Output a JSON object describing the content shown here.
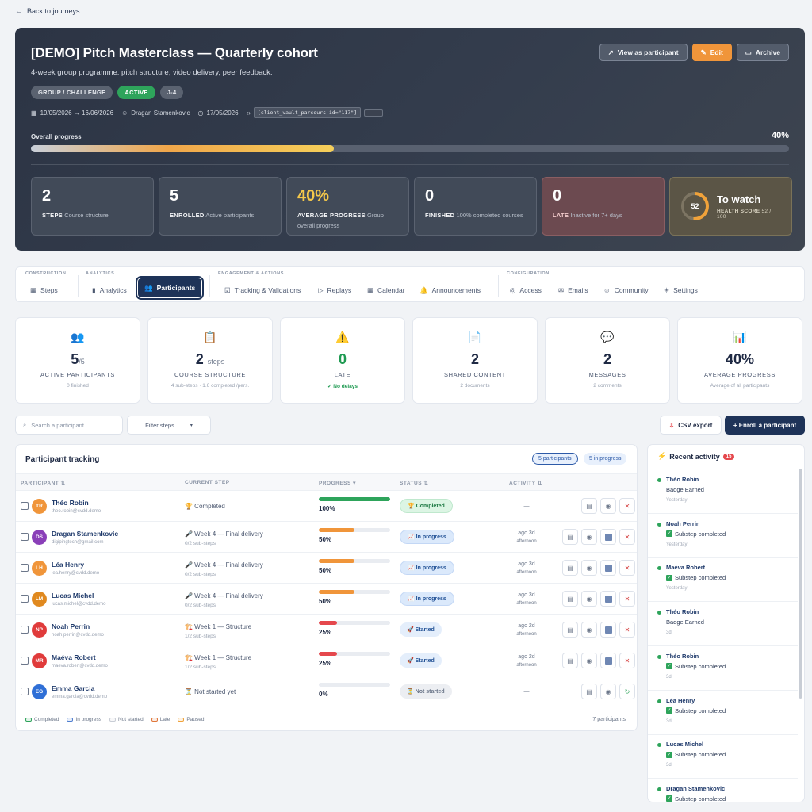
{
  "back": {
    "label": "Back to journeys"
  },
  "hero": {
    "title": "[DEMO] Pitch Masterclass — Quarterly cohort",
    "subtitle": "4-week group programme: pitch structure, video delivery, peer feedback.",
    "buttons": {
      "view": "View as participant",
      "edit": "Edit",
      "archive": "Archive"
    },
    "tags": [
      "GROUP / CHALLENGE",
      "ACTIVE",
      "J-4"
    ],
    "meta": {
      "dates": "19/05/2026 → 16/06/2026",
      "author": "Dragan Stamenkovic",
      "created": "17/05/2026",
      "code": "[client_vault_parcours id=\"117\"]"
    },
    "progress_label": "Overall progress",
    "progress_pct": "40%",
    "progress_value": 0.4,
    "kpis": [
      {
        "value": "2",
        "label": "STEPS",
        "desc": "Course structure"
      },
      {
        "value": "5",
        "label": "ENROLLED",
        "desc": "Active participants"
      },
      {
        "value": "40%",
        "label": "AVERAGE PROGRESS",
        "desc": "Group overall progress"
      },
      {
        "value": "0",
        "label": "FINISHED",
        "desc": "100% completed courses"
      },
      {
        "value": "0",
        "label": "LATE",
        "desc": "Inactive for 7+ days"
      }
    ],
    "health": {
      "score": "52",
      "title": "To watch",
      "label": "HEALTH SCORE",
      "sub": "52 / 100",
      "value": 0.52
    }
  },
  "tabs": {
    "groups": [
      "CONSTRUCTION",
      "ANALYTICS",
      "ENGAGEMENT & ACTIONS",
      "CONFIGURATION"
    ],
    "items": [
      "Steps",
      "Analytics",
      "Participants",
      "Tracking & Validations",
      "Replays",
      "Calendar",
      "Announcements",
      "Access",
      "Emails",
      "Community",
      "Settings"
    ]
  },
  "stats": [
    {
      "icon": "👥",
      "value": "5",
      "suffix": "/5",
      "label": "ACTIVE PARTICIPANTS",
      "desc": "0 finished"
    },
    {
      "icon": "📋",
      "value": "2",
      "suffix": "steps",
      "label": "COURSE STRUCTURE",
      "desc": "4 sub-steps · 1.6 completed /pers."
    },
    {
      "icon": "⚠️",
      "value": "0",
      "suffix": "",
      "label": "LATE",
      "desc": "✓ No delays"
    },
    {
      "icon": "📄",
      "value": "2",
      "suffix": "",
      "label": "SHARED CONTENT",
      "desc": "2 documents"
    },
    {
      "icon": "💬",
      "value": "2",
      "suffix": "",
      "label": "MESSAGES",
      "desc": "2 comments"
    },
    {
      "icon": "📊",
      "value": "40%",
      "suffix": "",
      "label": "AVERAGE PROGRESS",
      "desc": "Average of all participants"
    }
  ],
  "toolbar": {
    "search_placeholder": "Search a participant...",
    "filter": "Filter steps",
    "csv": "CSV export",
    "enroll": "+ Enroll a participant"
  },
  "table": {
    "title": "Participant tracking",
    "pill_participants": "5 participants",
    "pill_progress": "5 in progress",
    "headers": [
      "PARTICIPANT ⇅",
      "CURRENT STEP",
      "PROGRESS ▾",
      "STATUS ⇅",
      "ACTIVITY ⇅"
    ],
    "rows": [
      {
        "initials": "TR",
        "color": "#f0953a",
        "name": "Théo Robin",
        "email": "theo.robin@cvdd.demo",
        "step": "🏆 Completed",
        "substeps": "",
        "progress": "100%",
        "pval": 1.0,
        "bar": "#2ea45b",
        "status": "🏆 Completed",
        "stype": "done",
        "act1": "—",
        "act2": "",
        "extra": false
      },
      {
        "initials": "DS",
        "color": "#8a3fb8",
        "name": "Dragan Stamenkovic",
        "email": "digipingtech@gmail.com",
        "step": "🎤 Week 4 — Final delivery",
        "substeps": "0/2 sub-steps",
        "progress": "50%",
        "pval": 0.5,
        "bar": "#f0953a",
        "status": "📈 In progress",
        "stype": "prog",
        "act1": "ago 3d",
        "act2": "afternoon",
        "extra": true
      },
      {
        "initials": "LH",
        "color": "#f0953a",
        "name": "Léa Henry",
        "email": "lea.henry@cvdd.demo",
        "step": "🎤 Week 4 — Final delivery",
        "substeps": "0/2 sub-steps",
        "progress": "50%",
        "pval": 0.5,
        "bar": "#f0953a",
        "status": "📈 In progress",
        "stype": "prog",
        "act1": "ago 3d",
        "act2": "afternoon",
        "extra": true
      },
      {
        "initials": "LM",
        "color": "#e0891f",
        "name": "Lucas Michel",
        "email": "lucas.michel@cvdd.demo",
        "step": "🎤 Week 4 — Final delivery",
        "substeps": "0/2 sub-steps",
        "progress": "50%",
        "pval": 0.5,
        "bar": "#f0953a",
        "status": "📈 In progress",
        "stype": "prog",
        "act1": "ago 3d",
        "act2": "afternoon",
        "extra": true
      },
      {
        "initials": "NP",
        "color": "#e03b3b",
        "name": "Noah Perrin",
        "email": "noah.perrin@cvdd.demo",
        "step": "🏗️ Week 1 — Structure",
        "substeps": "1/2 sub-steps",
        "progress": "25%",
        "pval": 0.25,
        "bar": "#e5484d",
        "status": "🚀 Started",
        "stype": "start",
        "act1": "ago 2d",
        "act2": "afternoon",
        "extra": true
      },
      {
        "initials": "MR",
        "color": "#e03b3b",
        "name": "Maéva Robert",
        "email": "maeva.robert@cvdd.demo",
        "step": "🏗️ Week 1 — Structure",
        "substeps": "1/2 sub-steps",
        "progress": "25%",
        "pval": 0.25,
        "bar": "#e5484d",
        "status": "🚀 Started",
        "stype": "start",
        "act1": "ago 2d",
        "act2": "afternoon",
        "extra": true
      },
      {
        "initials": "EG",
        "color": "#2f6fd6",
        "name": "Emma Garcia",
        "email": "emma.garcia@cvdd.demo",
        "step": "⏳ Not started yet",
        "substeps": "",
        "progress": "0%",
        "pval": 0,
        "bar": "#c8cdd5",
        "status": "⏳ Not started",
        "stype": "not",
        "act1": "—",
        "act2": "",
        "extra": false,
        "restart": true
      }
    ],
    "legend": [
      "Completed",
      "In progress",
      "Not started",
      "Late",
      "Paused"
    ],
    "legend_colors": [
      "#2ea45b",
      "#4f7fd0",
      "#c8cdd5",
      "#e0763a",
      "#f0a23a"
    ],
    "count": "7 participants"
  },
  "activity": {
    "title": "Recent activity",
    "badge": "15",
    "items": [
      {
        "name": "Théo Robin",
        "text": "Badge Earned",
        "check": false,
        "date": "Yesterday"
      },
      {
        "name": "Noah Perrin",
        "text": "Substep completed",
        "check": true,
        "date": "Yesterday"
      },
      {
        "name": "Maéva Robert",
        "text": "Substep completed",
        "check": true,
        "date": "Yesterday"
      },
      {
        "name": "Théo Robin",
        "text": "Badge Earned",
        "check": false,
        "date": "3d"
      },
      {
        "name": "Théo Robin",
        "text": "Substep completed",
        "check": true,
        "date": "3d"
      },
      {
        "name": "Léa Henry",
        "text": "Substep completed",
        "check": true,
        "date": "3d"
      },
      {
        "name": "Lucas Michel",
        "text": "Substep completed",
        "check": true,
        "date": "3d"
      },
      {
        "name": "Dragan Stamenkovic",
        "text": "Substep completed",
        "check": true,
        "date": ""
      }
    ]
  }
}
